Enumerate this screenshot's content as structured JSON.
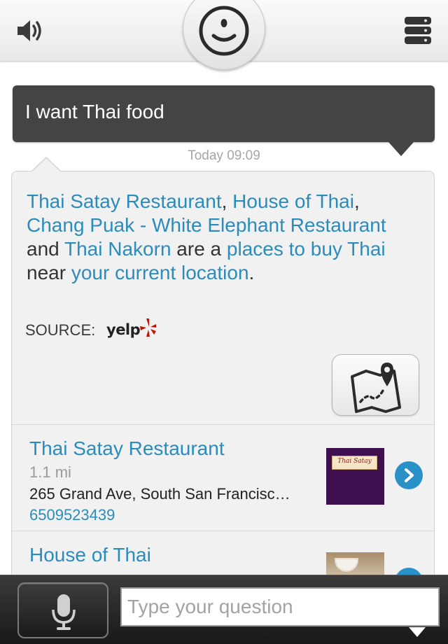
{
  "header": {
    "speaker_icon": "speaker-icon",
    "menu_icon": "menu-list-icon",
    "assistant_icon": "smiley-face-icon"
  },
  "conversation": {
    "user_message": "I want Thai food",
    "timestamp": "Today 09:09"
  },
  "answer": {
    "segments": [
      {
        "text": "Thai Satay Restaurant",
        "link": true
      },
      {
        "text": ", ",
        "link": false
      },
      {
        "text": "House of Thai",
        "link": true
      },
      {
        "text": ", ",
        "link": false
      },
      {
        "text": "Chang Puak - White Elephant Restaurant",
        "link": true
      },
      {
        "text": " and ",
        "link": false
      },
      {
        "text": "Thai Nakorn",
        "link": true
      },
      {
        "text": " are a ",
        "link": false
      },
      {
        "text": "places to buy Thai",
        "link": true
      },
      {
        "text": " near ",
        "link": false
      },
      {
        "text": "your current location",
        "link": true
      },
      {
        "text": ".",
        "link": false
      }
    ],
    "source_label": "SOURCE:",
    "source_logo": "yelp",
    "map_icon": "map-pin-icon"
  },
  "results": [
    {
      "name": "Thai Satay Restaurant",
      "distance": "1.1 mi",
      "address": "265 Grand Ave, South San Francisc…",
      "phone": "6509523439",
      "thumb_sign": "Thai Satay"
    },
    {
      "name": "House of Thai",
      "distance": "",
      "address": "",
      "phone": ""
    }
  ],
  "input": {
    "placeholder": "Type your question",
    "mic_icon": "microphone-icon"
  },
  "colors": {
    "link": "#2a8cbc",
    "user_bubble": "#444444",
    "card_bg": "#f1f1f1",
    "chevron": "#2a90c8"
  }
}
